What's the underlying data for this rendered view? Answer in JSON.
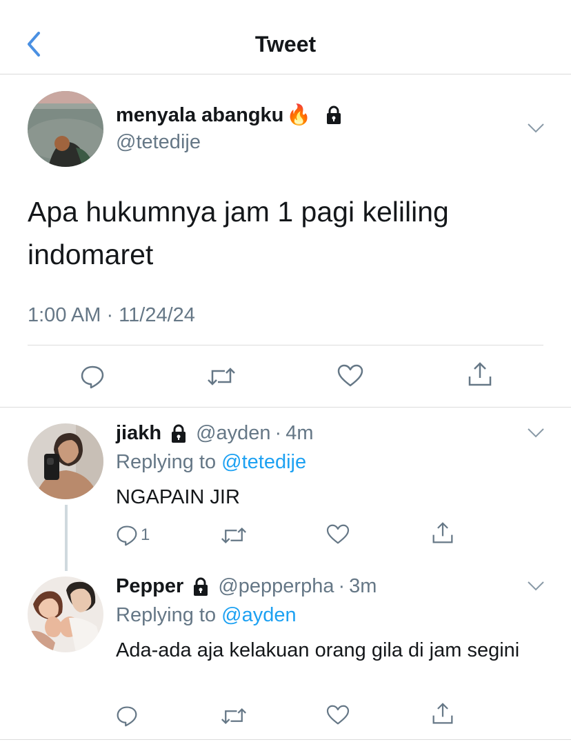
{
  "nav": {
    "title": "Tweet",
    "back_icon": "chevron-left-icon"
  },
  "tweet": {
    "display_name": "menyala abangku",
    "emoji": "🔥",
    "handle": "@tetedije",
    "text": "Apa hukumnya jam 1 pagi keliling indomaret",
    "timestamp": "1:00 AM · 11/24/24",
    "actions": [
      "reply-icon",
      "retweet-icon",
      "like-icon",
      "share-icon"
    ]
  },
  "replies": [
    {
      "name": "jiakh",
      "handle": "@ayden",
      "separator": "·",
      "time": "4m",
      "replying_prefix": "Replying to",
      "replying_to": "@tetedije",
      "text": "NGAPAIN JIR",
      "reply_count": "1"
    },
    {
      "name": "Pepper",
      "handle": "@pepperpha",
      "separator": "·",
      "time": "3m",
      "replying_prefix": "Replying to",
      "replying_to": "@ayden",
      "text": "Ada-ada aja kelakuan orang gila di jam segini",
      "reply_count": ""
    }
  ],
  "colors": {
    "accent": "#1da1f2",
    "secondary_text": "#657786",
    "primary_text": "#14171a",
    "divider": "#dcdcdc",
    "back_arrow": "#4a90e2"
  }
}
